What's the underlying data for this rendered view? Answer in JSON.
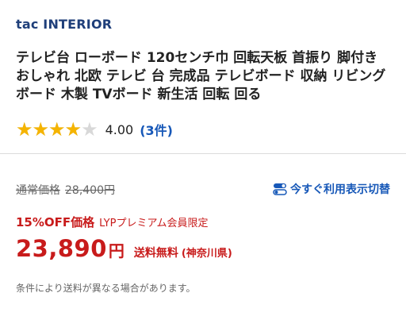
{
  "store": {
    "name": "tac INTERIOR"
  },
  "product": {
    "title": "テレビ台 ローボード 120センチ巾 回転天板 首振り 脚付き おしゃれ 北欧 テレビ 台 完成品 テレビボード 収納 リビングボード 木製 TVボード 新生活 回転 回る"
  },
  "rating": {
    "stars": 4.0,
    "max": 5,
    "score_text": "4.00",
    "count_text": "(3件)"
  },
  "pricing": {
    "regular_label": "通常価格",
    "regular_price": "28,400円",
    "switch_label": "今すぐ利用表示切替",
    "sale_label": "15%OFF価格",
    "sale_note": "LYPプレミアム会員限定",
    "sale_price": "23,890",
    "currency": "円",
    "shipping_label": "送料無料",
    "shipping_region": "(神奈川県)",
    "footnote": "条件により送料が異なる場合があります。"
  },
  "colors": {
    "accent_red": "#c81b1b",
    "link_blue": "#1758b8",
    "star_gold": "#f5b400",
    "store_navy": "#1f3f7a"
  },
  "icons": {
    "switch": "toggle-icon",
    "rating": "star-icon"
  }
}
